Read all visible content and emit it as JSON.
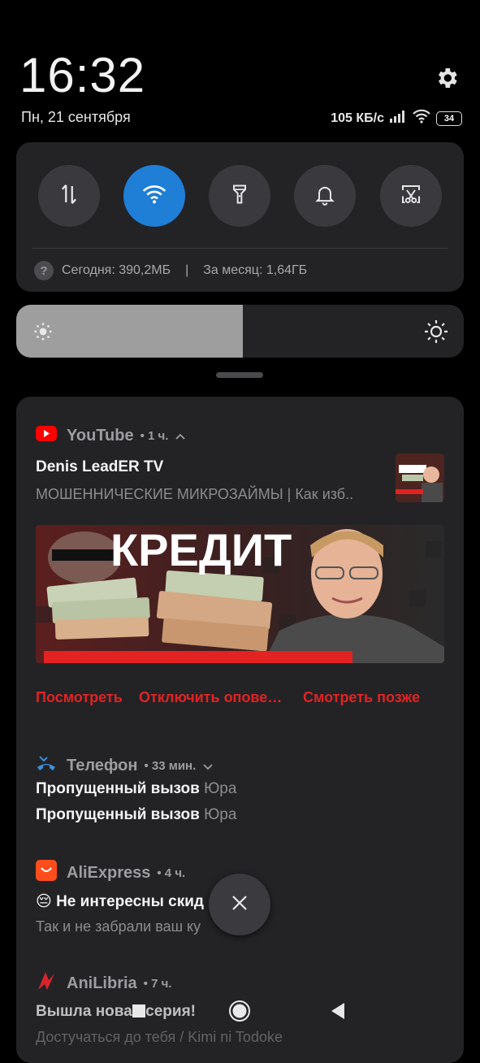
{
  "header": {
    "time": "16:32",
    "date": "Пн, 21 сентября",
    "net_speed": "105 КБ/с",
    "battery": "34"
  },
  "quick_settings": {
    "tiles": [
      {
        "name": "mobile-data",
        "icon": "data-arrows-icon",
        "active": false
      },
      {
        "name": "wifi",
        "icon": "wifi-icon",
        "active": true
      },
      {
        "name": "flashlight",
        "icon": "flashlight-icon",
        "active": false
      },
      {
        "name": "sound",
        "icon": "bell-icon",
        "active": false
      },
      {
        "name": "screenshot",
        "icon": "scissors-icon",
        "active": false
      }
    ],
    "usage_today": "Сегодня: 390,2МБ",
    "usage_separator": "|",
    "usage_month": "За месяц: 1,64ГБ",
    "accent": "#1f7ed6"
  },
  "brightness": {
    "level": 0.506
  },
  "notifications": {
    "youtube": {
      "app": "YouTube",
      "time": "• 1 ч.",
      "title": "Denis LeadER TV",
      "text": "МОШЕННИЧЕСКИЕ МИКРОЗАЙМЫ | Как изб..",
      "image_heading": "КРЕДИТ",
      "actions": [
        "Посмотреть",
        "Отключить опове…",
        "Смотреть позже"
      ],
      "action_color": "#e32222"
    },
    "phone": {
      "app": "Телефон",
      "time": "• 33 мин.",
      "lines": [
        {
          "title": "Пропущенный вызов",
          "who": "Юра"
        },
        {
          "title": "Пропущенный вызов",
          "who": "Юра"
        }
      ]
    },
    "aliexpress": {
      "app": "AliExpress",
      "time": "• 4 ч.",
      "title": "😔 Не интересны скид",
      "text": "Так и не забрали ваш ку"
    },
    "anilibria": {
      "app": "AniLibria",
      "time": "• 7 ч.",
      "title": "Вышла новая серия!",
      "text": "Достучаться до тебя / Kimi ni Todoke"
    }
  },
  "dismiss_icon": "close-icon",
  "nav": [
    "recents-icon",
    "home-icon",
    "back-icon"
  ]
}
